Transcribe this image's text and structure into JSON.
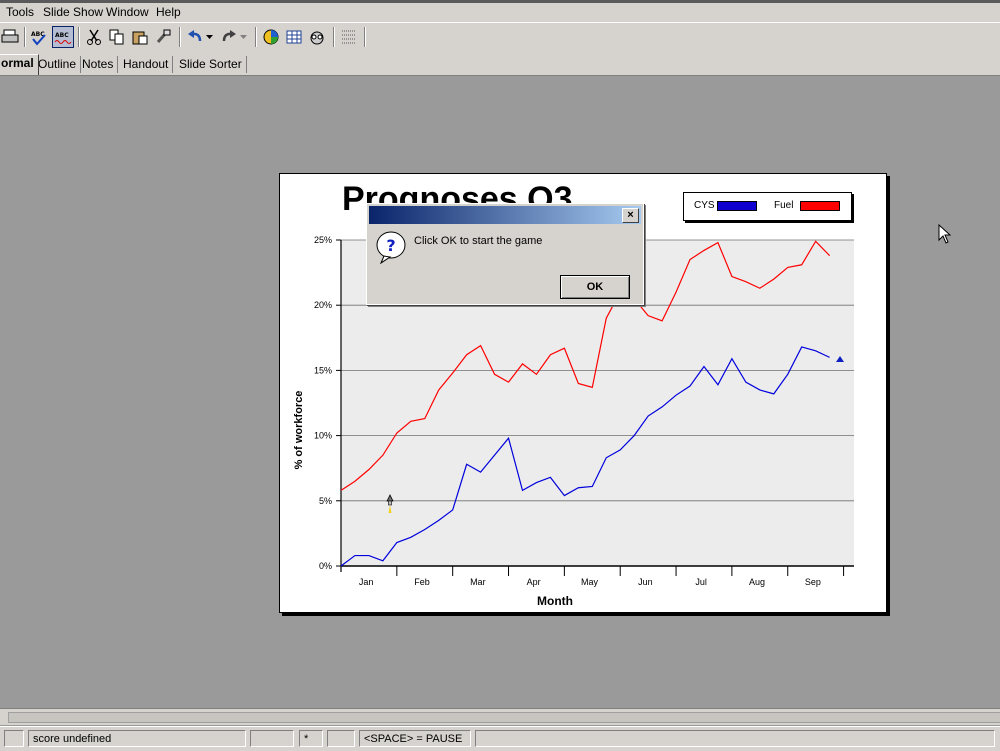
{
  "menu": {
    "items": [
      "Tools",
      "Slide Show",
      "Window",
      "Help"
    ]
  },
  "tabs": {
    "items": [
      "ormal",
      "Outline",
      "Notes",
      "Handout",
      "Slide Sorter"
    ],
    "active": 0
  },
  "slide": {
    "title": "Prognoses Q3"
  },
  "dialog": {
    "message": "Click OK to start the game",
    "ok_label": "OK",
    "close_label": "×"
  },
  "status": {
    "score": "score undefined",
    "star": "*",
    "pause": "<SPACE> = PAUSE"
  },
  "colors": {
    "cys": "#0000dd",
    "fuel": "#ff0000",
    "slide_bg": "#ececec"
  },
  "chart_data": {
    "type": "line",
    "ylabel": "% of workforce",
    "xlabel": "Month",
    "categories": [
      "Jan",
      "Feb",
      "Mar",
      "Apr",
      "May",
      "Jun",
      "Jul",
      "Aug",
      "Sep"
    ],
    "ylim": [
      0,
      25
    ],
    "yticks": [
      "0%",
      "5%",
      "10%",
      "15%",
      "20%",
      "25%"
    ],
    "legend": {
      "position": "top-right",
      "entries": [
        "CYS",
        "Fuel"
      ]
    },
    "series": [
      {
        "name": "Fuel",
        "x": [
          0,
          0.25,
          0.5,
          0.75,
          1,
          1.25,
          1.5,
          1.75,
          2,
          2.25,
          2.5,
          2.75,
          3,
          3.25,
          3.5,
          3.75,
          4,
          4.25,
          4.5,
          4.75,
          5,
          5.25,
          5.5,
          5.75,
          6,
          6.25,
          6.5,
          6.75,
          7,
          7.25,
          7.5,
          7.75,
          8,
          8.25,
          8.5,
          8.75
        ],
        "values": [
          5.8,
          6.5,
          7.4,
          8.5,
          10.2,
          11.1,
          11.3,
          13.5,
          14.8,
          16.2,
          16.9,
          14.7,
          14.1,
          15.5,
          14.7,
          16.2,
          16.7,
          14,
          13.7,
          19,
          21,
          20.5,
          19.2,
          18.8,
          21,
          23.5,
          24.2,
          24.8,
          22.2,
          21.8,
          21.3,
          22,
          22.9,
          23.1,
          24.9,
          23.8
        ]
      },
      {
        "name": "CYS",
        "x": [
          0,
          0.25,
          0.5,
          0.75,
          1,
          1.25,
          1.5,
          1.75,
          2,
          2.25,
          2.5,
          2.75,
          3,
          3.25,
          3.5,
          3.75,
          4,
          4.25,
          4.5,
          4.75,
          5,
          5.25,
          5.5,
          5.75,
          6,
          6.25,
          6.5,
          6.75,
          7,
          7.25,
          7.5,
          7.75,
          8,
          8.25,
          8.5,
          8.75
        ],
        "values": [
          0,
          0.8,
          0.8,
          0.4,
          1.8,
          2.2,
          2.8,
          3.5,
          4.3,
          7.8,
          7.2,
          8.5,
          9.8,
          5.8,
          6.4,
          6.8,
          5.4,
          6,
          6.1,
          8.3,
          8.9,
          10,
          11.5,
          12.2,
          13.1,
          13.8,
          15.3,
          13.9,
          15.9,
          14.1,
          13.5,
          13.2,
          14.7,
          16.8,
          16.5,
          16
        ]
      }
    ]
  }
}
